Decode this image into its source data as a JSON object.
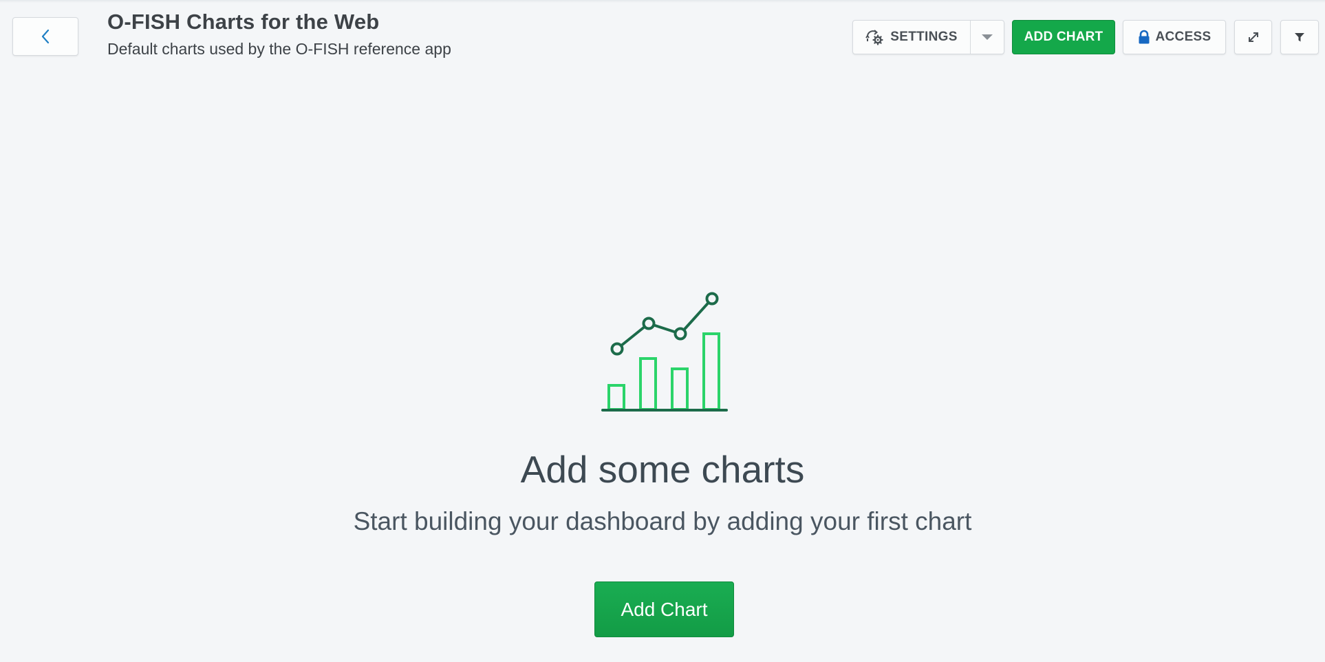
{
  "header": {
    "title": "O-FISH Charts for the Web",
    "subtitle": "Default charts used by the O-FISH reference app"
  },
  "toolbar": {
    "settings_label": "SETTINGS",
    "add_chart_label": "ADD CHART",
    "access_label": "ACCESS"
  },
  "empty_state": {
    "title": "Add some charts",
    "text": "Start building your dashboard by adding your first chart",
    "button_label": "Add Chart"
  },
  "icons": {
    "back": "chevron-left-icon",
    "settings": "refresh-gear-icon",
    "dropdown": "caret-down-icon",
    "access": "lock-icon",
    "fullscreen": "expand-icon",
    "filter": "filter-icon",
    "illustration": "chart-illustration-icon"
  },
  "colors": {
    "accent_green": "#14a84a",
    "dark_green": "#1c6b4a",
    "bright_green": "#2bd46a",
    "link_blue": "#1e7fc4",
    "lock_blue": "#1768c2"
  }
}
